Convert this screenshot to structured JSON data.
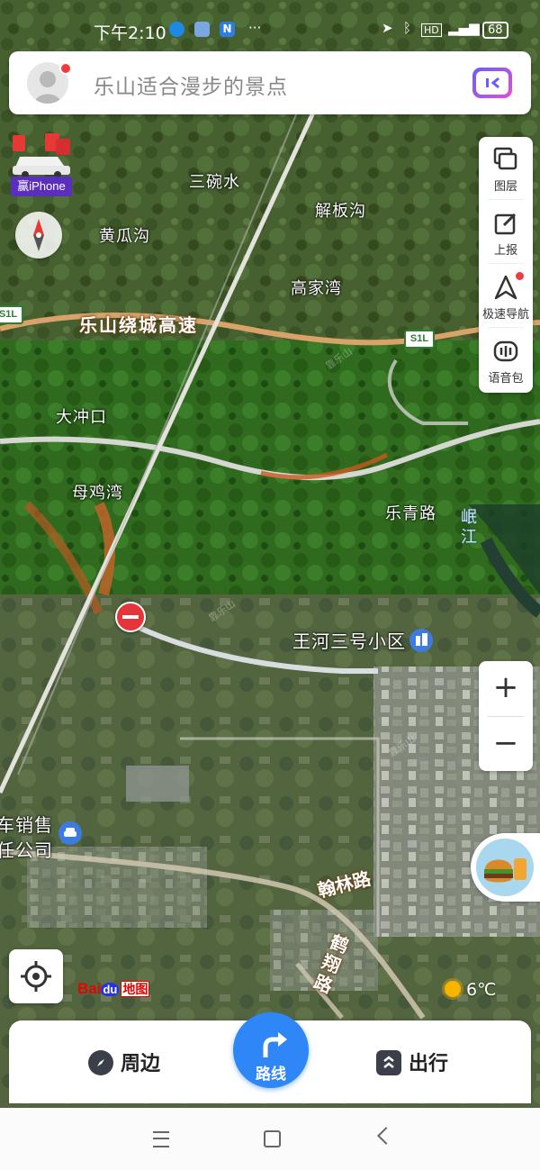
{
  "status_bar": {
    "time": "下午2:10",
    "app_icons": [
      "circle-app-icon",
      "cloud-app-icon",
      "n-app-icon"
    ],
    "more": "···",
    "battery": "68"
  },
  "search": {
    "placeholder": "乐山适合漫步的景点"
  },
  "promo": {
    "label": "赢iPhone"
  },
  "toolbar": {
    "items": [
      {
        "label": "图层",
        "icon": "layers-icon"
      },
      {
        "label": "上报",
        "icon": "report-icon"
      },
      {
        "label": "极速导航",
        "icon": "navigation-icon",
        "badge": true
      },
      {
        "label": "语音包",
        "icon": "voice-pack-icon"
      }
    ]
  },
  "zoom": {
    "in": "+",
    "out": "−"
  },
  "map": {
    "places": {
      "sanwanshui": "三碗水",
      "huangguagou": "黄瓜沟",
      "jiebangou": "解板沟",
      "gaojiawan": "高家湾",
      "dachongkou": "大冲口",
      "mujiwan": "母鸡湾",
      "wanghe": "王河三号小区",
      "car_dealer_1": "车销售",
      "car_dealer_2": "任公司"
    },
    "roads": {
      "ring_expressway": "乐山绕城高速",
      "leqing": "乐青路",
      "hanlin": "翰林路",
      "heyi": "鹤翔路"
    },
    "river": "岷江",
    "shields": [
      "S1L",
      "S1L"
    ]
  },
  "logo": {
    "bai": "Bai",
    "du": "du",
    "ditu": "地图"
  },
  "weather": {
    "temp": "6℃"
  },
  "bottom": {
    "nearby": "周边",
    "route": "路线",
    "travel": "出行"
  },
  "watermark": "靠乐山"
}
